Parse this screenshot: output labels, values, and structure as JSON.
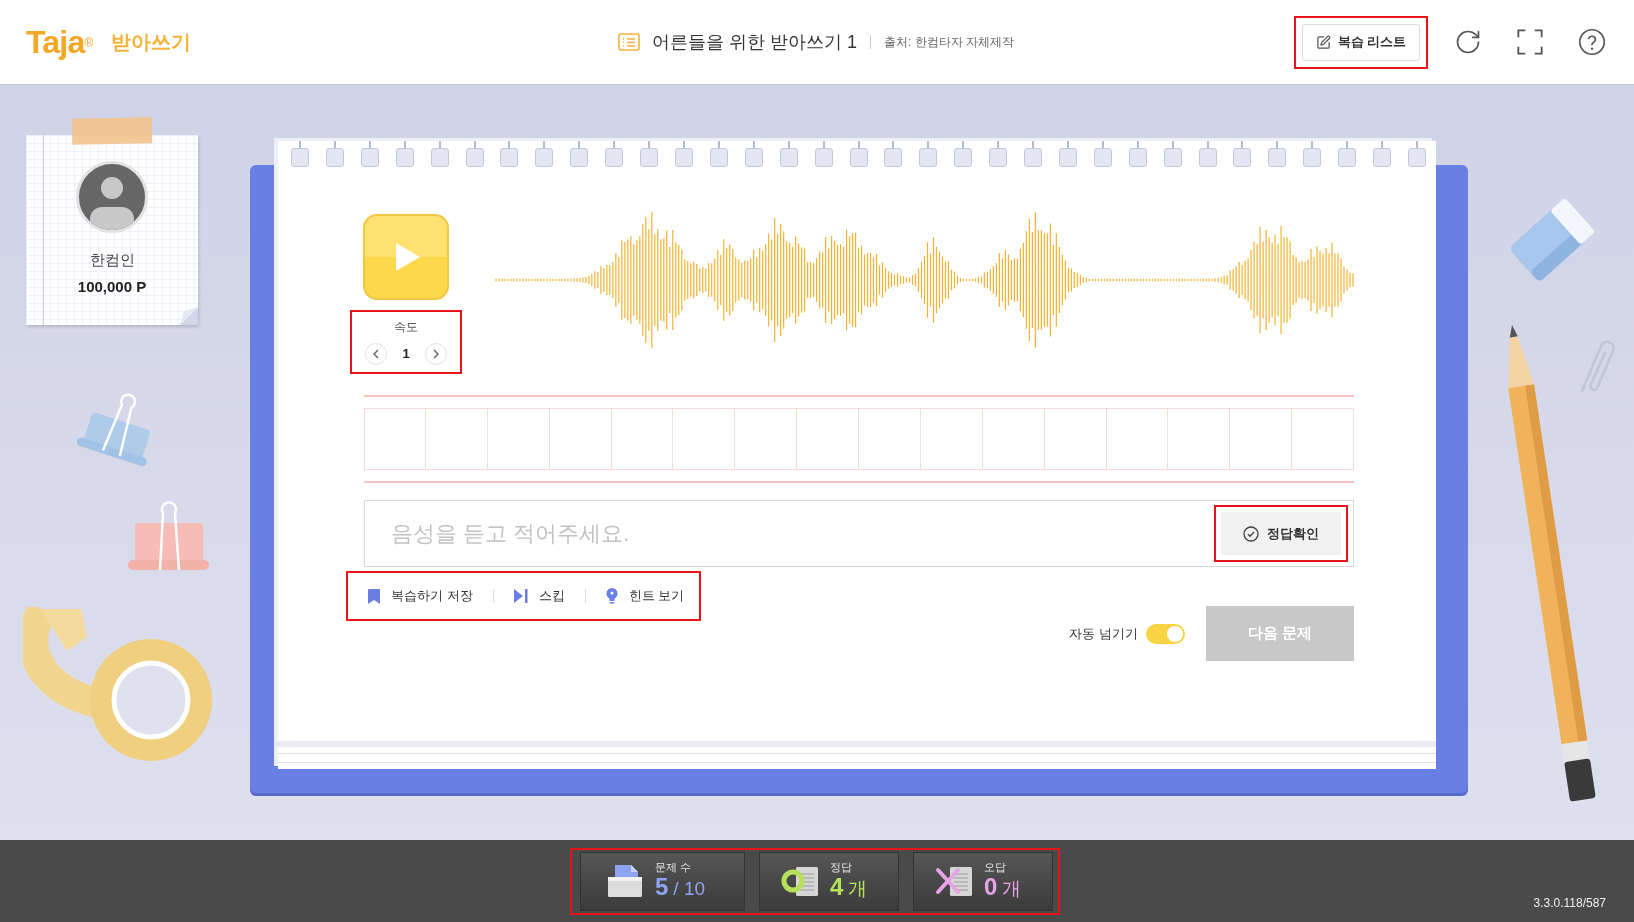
{
  "header": {
    "logo": "Taja$^{®}$",
    "app_name": "받아쓰기",
    "title": "어른들을 위한 받아쓰기 1",
    "source": "출처: 한컴타자 자체제작",
    "review_button": "복습 리스트"
  },
  "profile": {
    "name": "한컴인",
    "points": "100,000 P"
  },
  "player": {
    "speed_label": "속도",
    "speed_value": "1"
  },
  "answer": {
    "placeholder": "음성을 듣고 적어주세요.",
    "check_button": "정답확인"
  },
  "actions": [
    {
      "kind": "bookmark",
      "label": "복습하기 저장"
    },
    {
      "kind": "skip",
      "label": "스킵"
    },
    {
      "kind": "hint",
      "label": "힌트 보기"
    }
  ],
  "auto_next": {
    "label": "자동 넘기기",
    "on": true
  },
  "next_button": {
    "label": "다음 문제",
    "disabled": true
  },
  "stats": [
    {
      "kind": "count",
      "label": "문제 수",
      "value": "5",
      "suffix": "/ 10",
      "color": "#8ea4f2"
    },
    {
      "kind": "correct",
      "label": "정답",
      "value": "4",
      "suffix": "개",
      "color": "#b4e05c"
    },
    {
      "kind": "wrong",
      "label": "오답",
      "value": "0",
      "suffix": "개",
      "color": "#e8a3e6"
    }
  ],
  "version": "3.3.0.118/587"
}
